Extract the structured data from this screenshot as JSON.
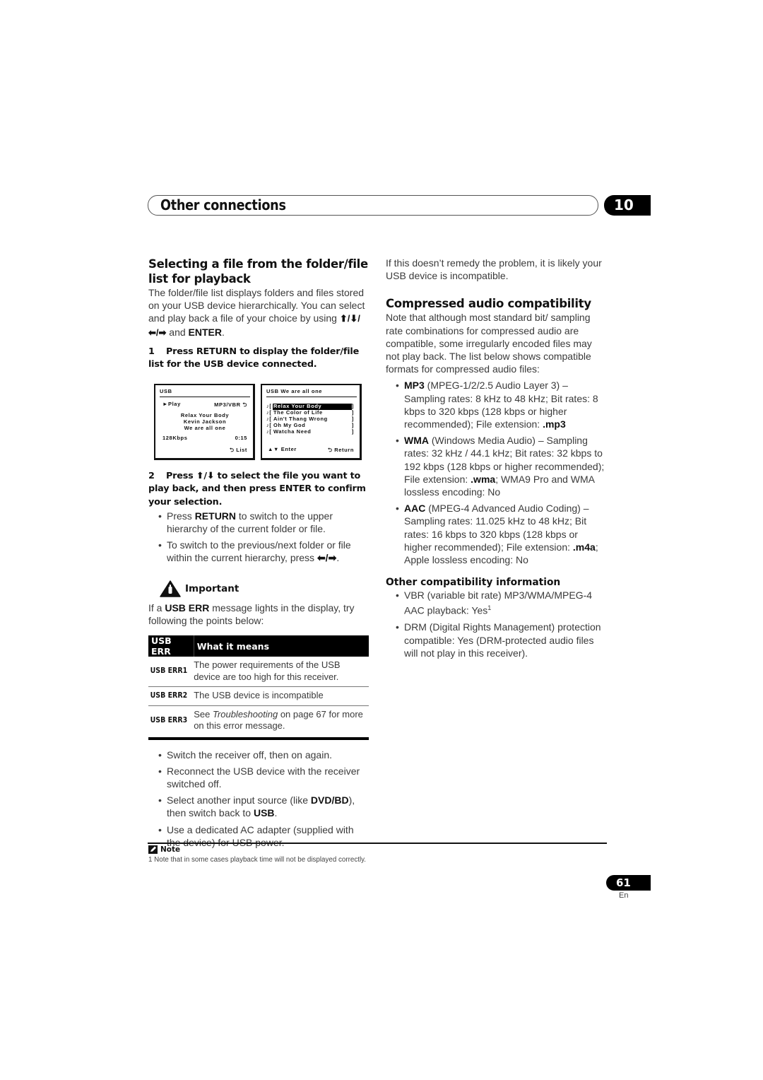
{
  "header": {
    "chapter_title": "Other connections",
    "chapter_number": "10"
  },
  "left": {
    "section_title": "Selecting a file from the folder/file list for playback",
    "intro_text": "The folder/file list displays folders and files stored on your USB device hierarchically. You can select and play back a file of your choice by using",
    "intro_arrows": "⬆/⬇/⬅/➡",
    "intro_and": "and",
    "intro_enter": "ENTER",
    "step1_num": "1",
    "step1_text": "Press RETURN to display the folder/file list for the USB device connected.",
    "screen1": {
      "title": "USB",
      "play_label": "►Play",
      "format": "MP3/VBR ⮌",
      "track_lines": [
        "Relax Your Body",
        "Kevin Jackson",
        "We are all one"
      ],
      "bitrate": "128Kbps",
      "time": "0:15",
      "list_button": "⮌ List"
    },
    "screen2": {
      "title": "USB  We are all one",
      "items": [
        {
          "title": "Relax Your Body",
          "selected": true
        },
        {
          "title": "The Color of Life",
          "selected": false
        },
        {
          "title": "Ain't Thang Wrong",
          "selected": false
        },
        {
          "title": "Oh My God",
          "selected": false
        },
        {
          "title": "Watcha Need",
          "selected": false
        }
      ],
      "enter_button": "▲▼ Enter",
      "return_button": "⮌ Return"
    },
    "step2_num": "2",
    "step2_pre": "Press",
    "step2_arrows": "⬆/⬇",
    "step2_text": "to select the file you want to play back, and then press ENTER to confirm your selection.",
    "step2_bullets": [
      {
        "pre": "Press ",
        "bold": "RETURN",
        "post": " to switch to the upper hierarchy of the current folder or file."
      },
      {
        "pre": "To switch to the previous/next folder or file within the current hierarchy, press ",
        "bold": "⬅/➡",
        "post": "."
      }
    ],
    "important_label": "Important",
    "important_pre": "If a ",
    "important_bold": "USB ERR",
    "important_post": " message lights in the display, try following the points below:",
    "table": {
      "headers": [
        "USB ERR",
        "What it means"
      ],
      "rows": [
        {
          "code": "USB ERR1",
          "meaning": "The power requirements of the USB device are too high for this receiver."
        },
        {
          "code": "USB ERR2",
          "meaning": "The USB device is incompatible"
        },
        {
          "code": "USB ERR3",
          "meaning_pre": "See ",
          "meaning_italic": "Troubleshooting",
          "meaning_post": " on page 67 for more on this error message."
        }
      ]
    },
    "remedy_bullets": [
      {
        "pre": "Switch the receiver off, then on again."
      },
      {
        "pre": "Reconnect the USB device with the receiver switched off."
      },
      {
        "pre": "Select another input source (like ",
        "bold": "DVD/BD",
        "mid": "), then switch back to ",
        "bold2": "USB",
        "post": "."
      },
      {
        "pre": "Use a dedicated AC adapter (supplied with the device) for USB power."
      }
    ]
  },
  "right": {
    "continuation": "If this doesn’t remedy the problem, it is likely your USB device is incompatible.",
    "section_title": "Compressed audio compatibility",
    "intro": "Note that although most standard bit/ sampling rate combinations for compressed audio are compatible, some irregularly encoded files may not play back. The list below shows compatible formats for compressed audio files:",
    "formats": [
      {
        "name": "MP3",
        "desc": " (MPEG-1/2/2.5 Audio Layer 3) – Sampling rates: 8 kHz to 48 kHz; Bit rates: 8 kbps to 320 kbps (128 kbps or higher recommended); File extension: ",
        "ext": ".mp3",
        "tail": ""
      },
      {
        "name": "WMA",
        "desc": " (Windows Media Audio) – Sampling rates: 32 kHz / 44.1 kHz; Bit rates: 32 kbps to 192 kbps (128 kbps or higher recommended); File extension: ",
        "ext": ".wma",
        "tail": "; WMA9 Pro and WMA lossless encoding: No"
      },
      {
        "name": "AAC",
        "desc": " (MPEG-4 Advanced Audio Coding) – Sampling rates: 11.025 kHz to 48 kHz; Bit rates: 16 kbps to 320 kbps (128 kbps or higher recommended); File extension: ",
        "ext": ".m4a",
        "tail": "; Apple lossless encoding: No"
      }
    ],
    "other_title": "Other compatibility information",
    "other_bullets": [
      {
        "text": "VBR (variable bit rate) MP3/WMA/MPEG-4 AAC playback: Yes",
        "sup": "1"
      },
      {
        "text": "DRM (Digital Rights Management) protection compatible: Yes (DRM-protected audio files will not play in this receiver).",
        "sup": ""
      }
    ]
  },
  "footer": {
    "note_label": "Note",
    "footnote": "1 Note that in some cases playback time will not be displayed correctly.",
    "page_number": "61",
    "language": "En"
  }
}
